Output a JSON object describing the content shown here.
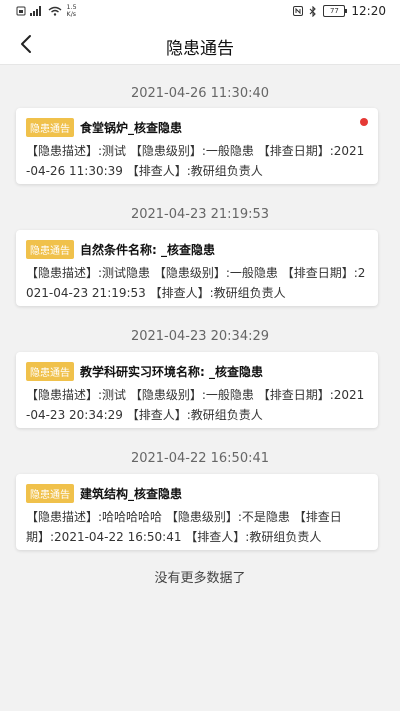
{
  "status_bar": {
    "network_speed_value": "1.5",
    "network_speed_unit": "K/s",
    "time": "12:20",
    "battery_level": "77"
  },
  "nav": {
    "title": "隐患通告"
  },
  "notices": [
    {
      "date": "2021-04-26 11:30:40",
      "badge": "隐患通告",
      "title": "食堂锅炉_核查隐患",
      "body": "【隐患描述】:测试 【隐患级别】:一般隐患 【排查日期】:2021-04-26 11:30:39 【排查人】:教研组负责人",
      "unread": true
    },
    {
      "date": "2021-04-23 21:19:53",
      "badge": "隐患通告",
      "title": "自然条件名称: _核查隐患",
      "body": "【隐患描述】:测试隐患 【隐患级别】:一般隐患 【排查日期】:2021-04-23 21:19:53 【排查人】:教研组负责人",
      "unread": false
    },
    {
      "date": "2021-04-23 20:34:29",
      "badge": "隐患通告",
      "title": "教学科研实习环境名称: _核查隐患",
      "body": "【隐患描述】:测试 【隐患级别】:一般隐患 【排查日期】:2021-04-23 20:34:29 【排查人】:教研组负责人",
      "unread": false
    },
    {
      "date": "2021-04-22 16:50:41",
      "badge": "隐患通告",
      "title": "建筑结构_核查隐患",
      "body": "【隐患描述】:哈哈哈哈哈 【隐患级别】:不是隐患 【排查日期】:2021-04-22 16:50:41 【排查人】:教研组负责人",
      "unread": false
    }
  ],
  "footer": {
    "no_more": "没有更多数据了"
  },
  "colors": {
    "badge": "#f0c14b",
    "unread_dot": "#e53935",
    "background": "#f2f2f2"
  }
}
